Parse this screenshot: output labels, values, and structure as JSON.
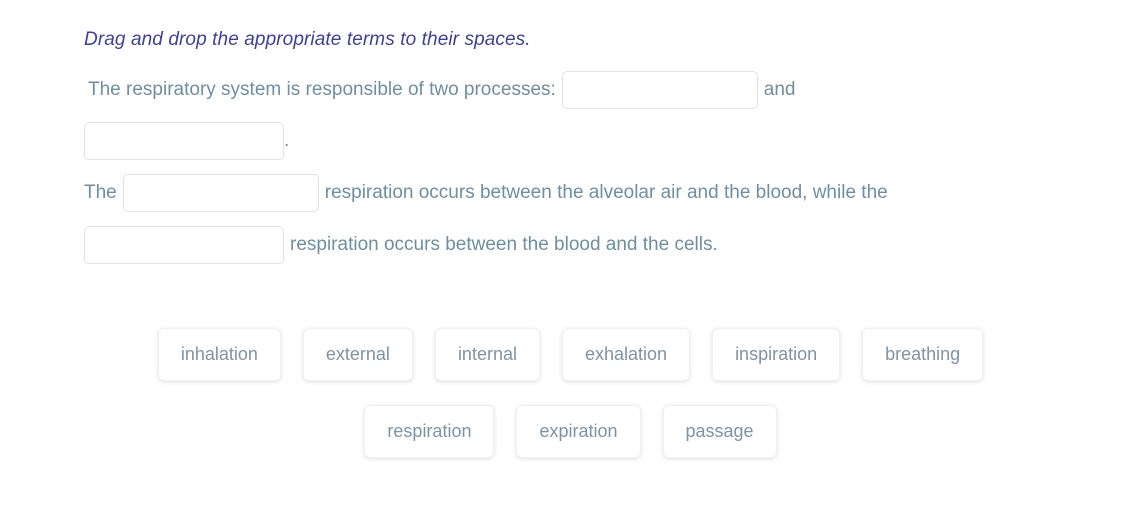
{
  "instruction": "Drag and drop the appropriate terms to their spaces.",
  "sentences": {
    "line1_before": "The respiratory system is responsible of two processes:",
    "line1_after": "and",
    "line2_after": ".",
    "line3_before": "The",
    "line3_after": "respiration occurs between the alveolar air and the blood, while the",
    "line4_after": "respiration occurs between the blood and the cells."
  },
  "blanks": [
    {
      "id": "blank-1",
      "value": "",
      "placeholder": ""
    },
    {
      "id": "blank-2",
      "value": "",
      "placeholder": ""
    },
    {
      "id": "blank-3",
      "value": "",
      "placeholder": ""
    },
    {
      "id": "blank-4",
      "value": "",
      "placeholder": ""
    }
  ],
  "term_rows": [
    {
      "terms": [
        {
          "label": "inhalation"
        },
        {
          "label": "external"
        },
        {
          "label": "internal"
        },
        {
          "label": "exhalation"
        },
        {
          "label": "inspiration"
        },
        {
          "label": "breathing"
        }
      ]
    },
    {
      "terms": [
        {
          "label": "respiration"
        },
        {
          "label": "expiration"
        },
        {
          "label": "passage"
        }
      ]
    }
  ],
  "colors": {
    "instruction_text": "#3f3f9c",
    "body_text": "#6f8fa1",
    "chip_text": "#7d94a3",
    "blank_border": "#e2e2e2",
    "background": "#ffffff"
  }
}
